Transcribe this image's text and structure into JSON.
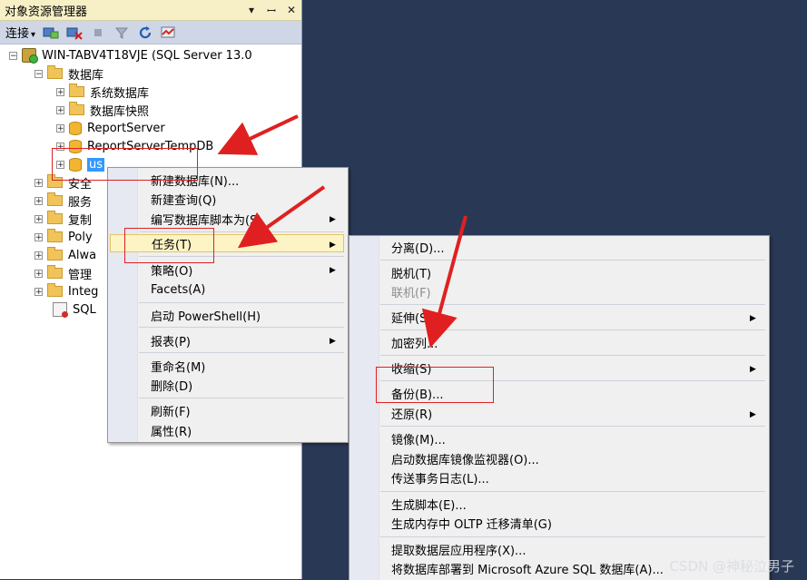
{
  "panel": {
    "title": "对象资源管理器",
    "title_buttons": [
      "▾",
      "ꟷ",
      "✕"
    ],
    "toolbar": {
      "connect_label": "连接",
      "connect_caret": "▾"
    }
  },
  "tree": {
    "server": "WIN-TABV4T18VJE (SQL Server 13.0",
    "databases": "数据库",
    "system_databases": "系统数据库",
    "snapshots": "数据库快照",
    "report_server": "ReportServer",
    "report_server_temp": "ReportServerTempDB",
    "selected_db": "us",
    "security": "安全",
    "server_objects": "服务",
    "replication": "复制",
    "polybase": "Poly",
    "always_on": "Alwa",
    "management": "管理",
    "integration": "Integ",
    "sql_agent": "SQL"
  },
  "context_menu": {
    "new_database": "新建数据库(N)...",
    "new_query": "新建查询(Q)",
    "script_as": "编写数据库脚本为(S)",
    "tasks": "任务(T)",
    "policies": "策略(O)",
    "facets": "Facets(A)",
    "powershell": "启动 PowerShell(H)",
    "reports": "报表(P)",
    "rename": "重命名(M)",
    "delete": "删除(D)",
    "refresh": "刷新(F)",
    "properties": "属性(R)"
  },
  "tasks_menu": {
    "detach": "分离(D)...",
    "take_offline": "脱机(T)",
    "bring_online": "联机(F)",
    "stretch": "延伸(S)",
    "encrypt_columns": "加密列...",
    "shrink": "收缩(S)",
    "backup": "备份(B)...",
    "restore": "还原(R)",
    "mirror": "镜像(M)...",
    "mirror_monitor": "启动数据库镜像监视器(O)...",
    "log_shipping": "传送事务日志(L)...",
    "generate_scripts": "生成脚本(E)...",
    "oltp_checklist": "生成内存中 OLTP 迁移清单(G)",
    "extract_dac": "提取数据层应用程序(X)...",
    "deploy_azure": "将数据库部署到 Microsoft Azure SQL 数据库(A)..."
  },
  "submenu_arrow": "▶",
  "watermark": "CSDN @神秘泣男子",
  "colors": {
    "background": "#293955",
    "title_bar": "#f7f0c6",
    "highlight": "#fdf4c5",
    "selection": "#3399ff",
    "annotation": "#e02020"
  }
}
